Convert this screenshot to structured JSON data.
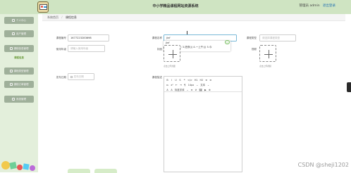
{
  "header": {
    "title": "中小学精品课程网站资源系统",
    "user_label": "管理员 admin",
    "logout_label": "退出登录"
  },
  "sidebar": {
    "items": [
      {
        "label": "系统首页"
      },
      {
        "label": "个人中心"
      },
      {
        "label": "用户管理"
      },
      {
        "label": "课程信息管理"
      },
      {
        "label": "课程信息"
      },
      {
        "label": "课程类型管理"
      },
      {
        "label": "课程订单管理"
      },
      {
        "label": "系统管理"
      }
    ]
  },
  "breadcrumb": {
    "home": "系统首页",
    "separator": "/",
    "current": "课程信息"
  },
  "form": {
    "course_no": {
      "label": "课程编号",
      "value": "1677223283698"
    },
    "course_name": {
      "label": "课程名称",
      "value": "jinf"
    },
    "course_type": {
      "label": "课程类型",
      "placeholder": "请选择课程类型"
    },
    "grade": {
      "label": "使用年级",
      "placeholder": "请输入使用年级"
    },
    "cover": {
      "label": "封面",
      "hint": "点击上传封面"
    },
    "video": {
      "label": "视频",
      "hint": "点击上传视频"
    },
    "publish_time": {
      "label": "发布日期",
      "placeholder": "发布日期"
    },
    "details": {
      "label": "课程描述"
    }
  },
  "ime": {
    "composition": "jinf",
    "candidates": "1.进 2.下午(j) 3.进修(j) 4.一上午(j) 5.今"
  },
  "editor": {
    "toolbar_row1": [
      "B",
      "I",
      "U",
      "S",
      "❝",
      "</>",
      "H1",
      "H2",
      "≡",
      "≡"
    ],
    "toolbar_row2": [
      "x₂",
      "x²",
      "⇤",
      "⇥",
      "¶",
      "14px",
      "⌄",
      "文本",
      "⌄"
    ],
    "toolbar_row3": [
      "A",
      "A",
      "标准字体",
      "⌄",
      "≡",
      "⊘",
      "🖼",
      "▶",
      "⊗"
    ]
  },
  "watermark": "CSDN @sheji1202"
}
